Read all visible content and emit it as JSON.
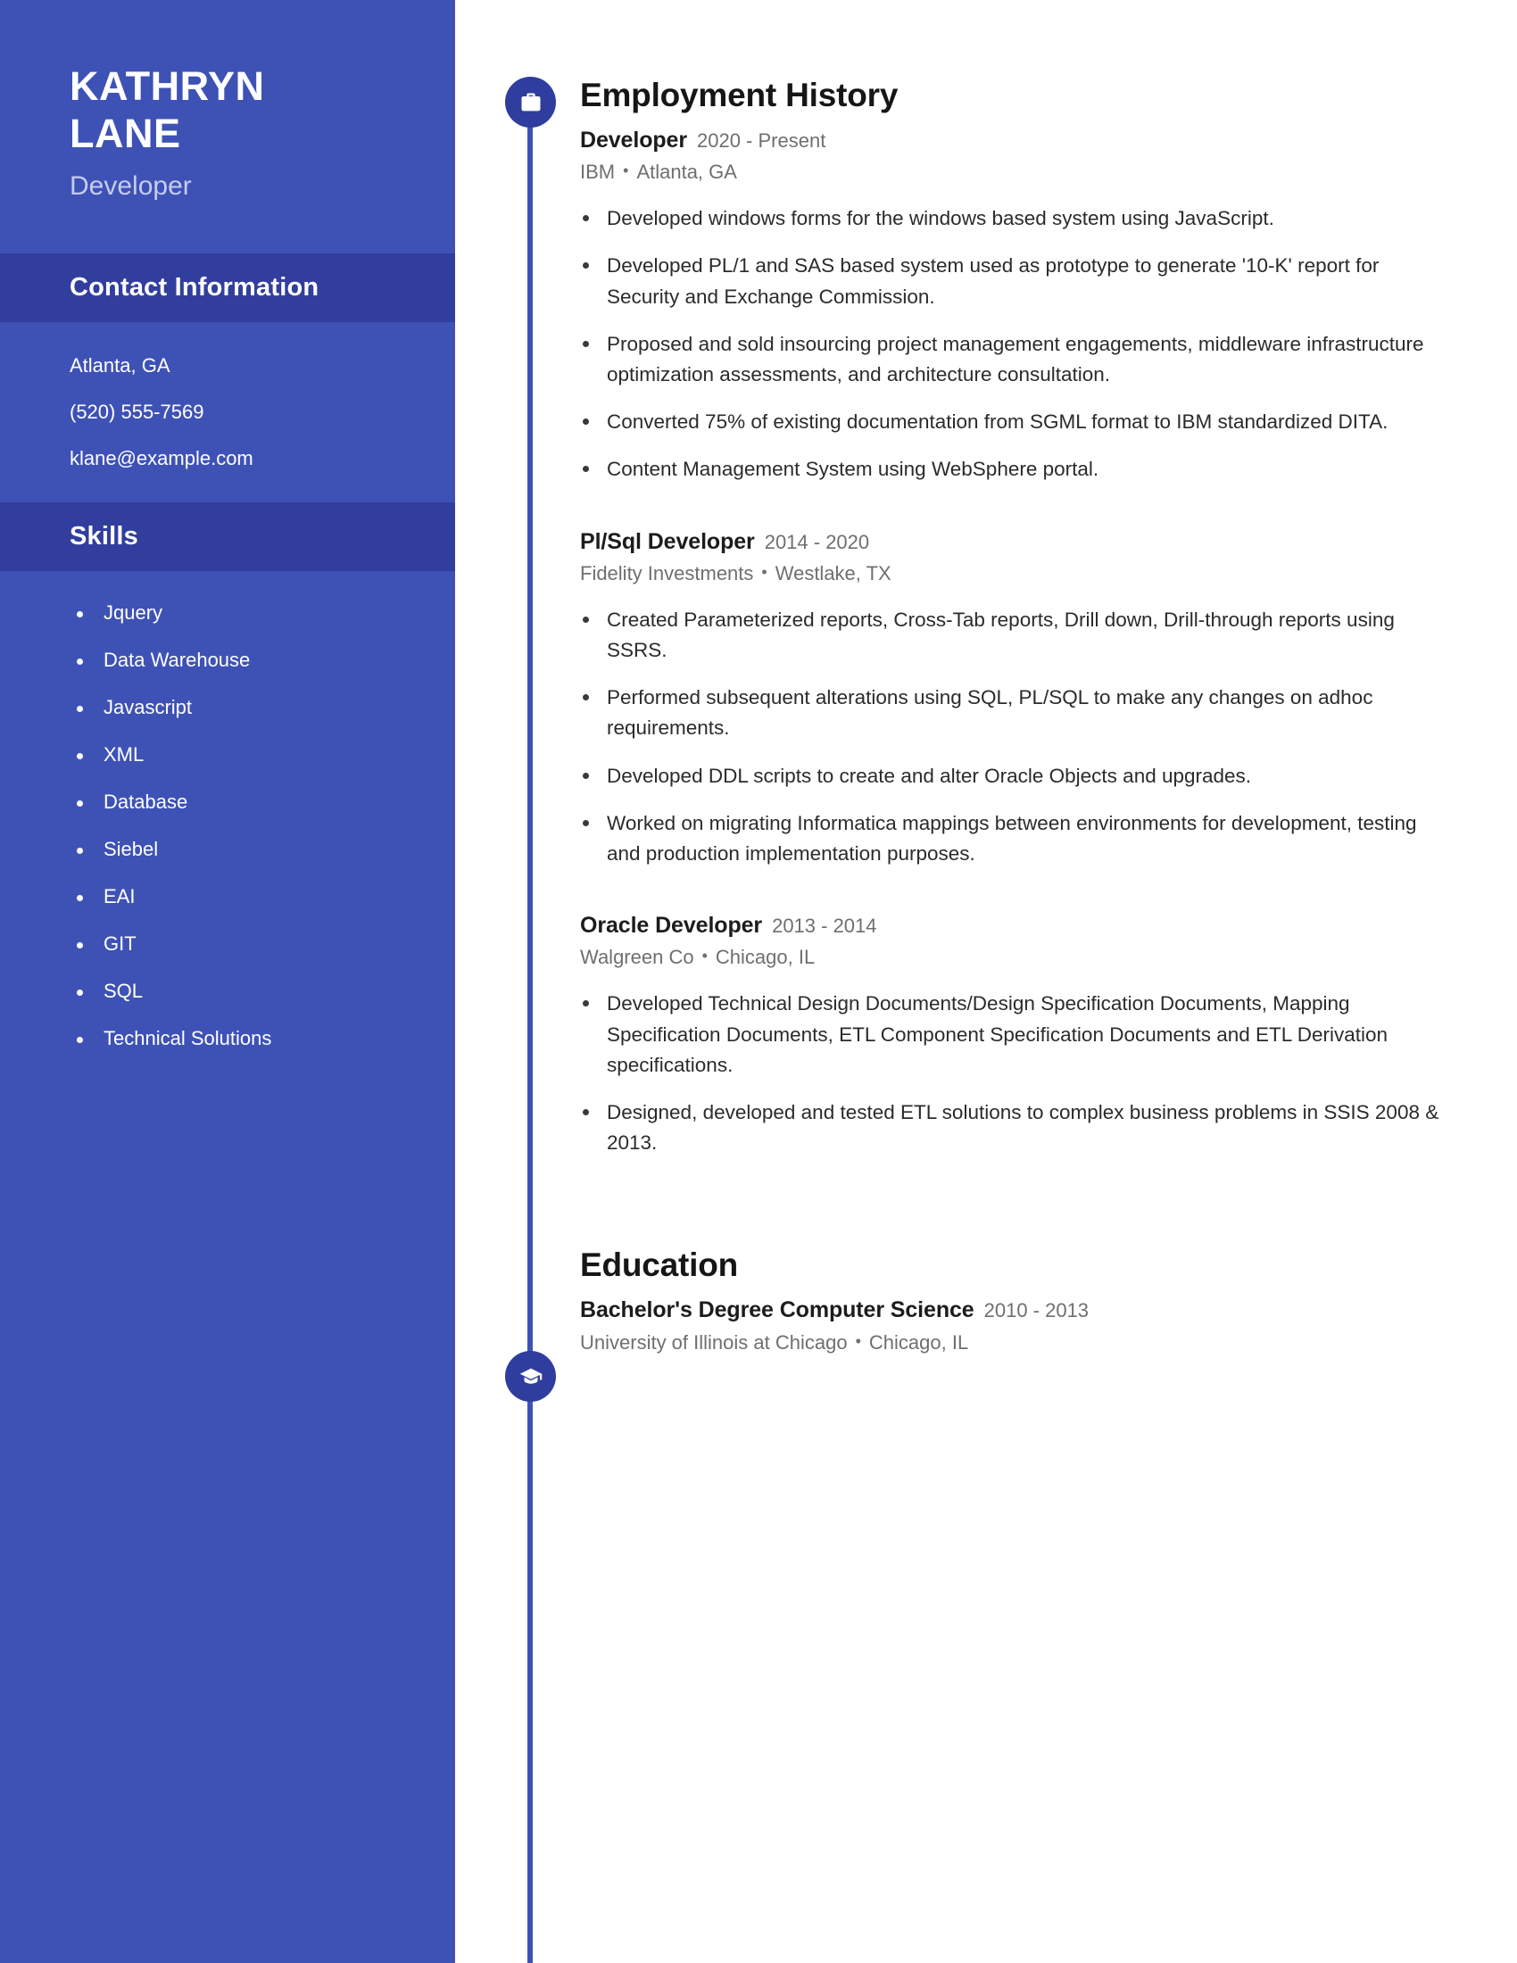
{
  "sidebar": {
    "name_lines": [
      "KATHRYN",
      "LANE"
    ],
    "job_title": "Developer",
    "contact_section": {
      "title": "Contact Information",
      "items": [
        "Atlanta, GA",
        "(520) 555-7569",
        "klane@example.com"
      ]
    },
    "skills_section": {
      "title": "Skills",
      "items": [
        "Jquery",
        "Data Warehouse",
        "Javascript",
        "XML",
        "Database",
        "Siebel",
        "EAI",
        "GIT",
        "SQL",
        "Technical Solutions"
      ]
    }
  },
  "main": {
    "employment": {
      "heading": "Employment History",
      "icon": "briefcase-icon",
      "entries": [
        {
          "title": "Developer",
          "dates": "2020 - Present",
          "company": "IBM",
          "location": "Atlanta, GA",
          "bullets": [
            "Developed windows forms for the windows based system using JavaScript.",
            "Developed PL/1 and SAS based system used as prototype to generate '10-K' report for Security and Exchange Commission.",
            "Proposed and sold insourcing project management engagements, middleware infrastructure optimization assessments, and architecture consultation.",
            "Converted 75% of existing documentation from SGML format to IBM standardized DITA.",
            "Content Management System using WebSphere portal."
          ]
        },
        {
          "title": "Pl/Sql Developer",
          "dates": "2014 - 2020",
          "company": "Fidelity Investments",
          "location": "Westlake, TX",
          "bullets": [
            "Created Parameterized reports, Cross-Tab reports, Drill down, Drill-through reports using SSRS.",
            "Performed subsequent alterations using SQL, PL/SQL to make any changes on adhoc requirements.",
            "Developed DDL scripts to create and alter Oracle Objects and upgrades.",
            "Worked on migrating Informatica mappings between environments for development, testing and production implementation purposes."
          ]
        },
        {
          "title": "Oracle Developer",
          "dates": "2013 - 2014",
          "company": "Walgreen Co",
          "location": "Chicago, IL",
          "bullets": [
            "Developed Technical Design Documents/Design Specification Documents, Mapping Specification Documents, ETL Component Specification Documents and ETL Derivation specifications.",
            "Designed, developed and tested ETL solutions to complex business problems in SSIS 2008 & 2013."
          ]
        }
      ]
    },
    "education": {
      "heading": "Education",
      "icon": "graduation-cap-icon",
      "entries": [
        {
          "title": "Bachelor's Degree Computer Science",
          "dates": "2010 - 2013",
          "school": "University of Illinois at Chicago",
          "location": "Chicago, IL"
        }
      ]
    }
  },
  "separator": "•",
  "colors": {
    "sidebar_bg": "#3e52b5",
    "sidebar_band": "#313e9e",
    "timeline": "#3e52b5",
    "node": "#2f3d9e",
    "heading_text": "#161616",
    "muted_text": "#6f6f6f"
  }
}
